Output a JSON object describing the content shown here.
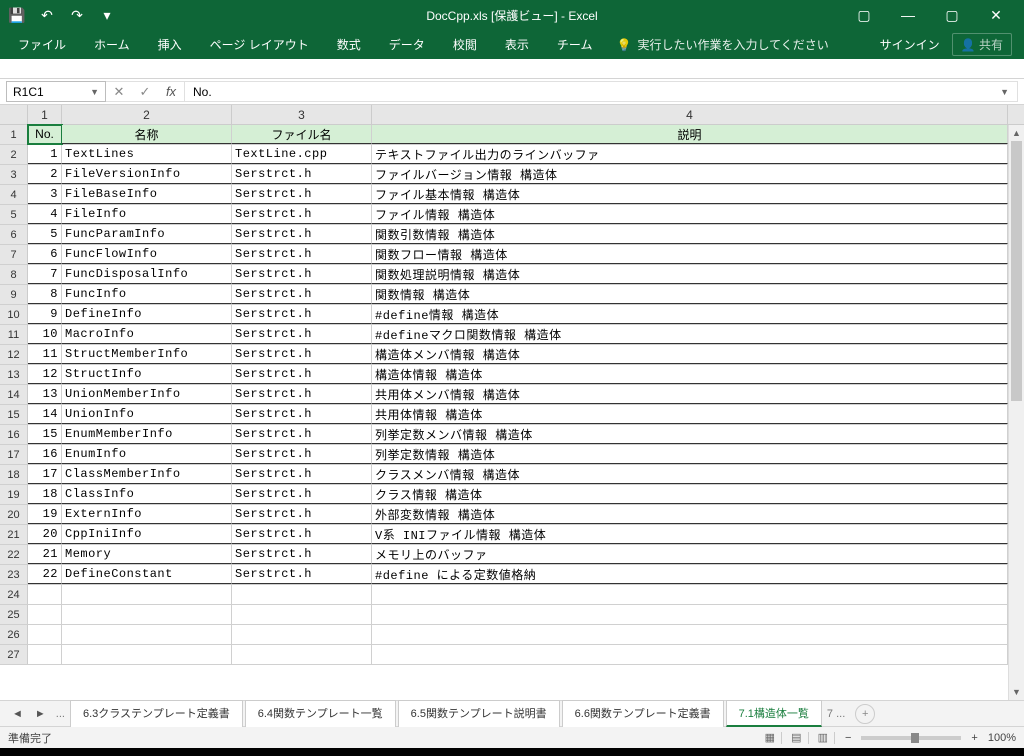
{
  "title": "DocCpp.xls [保護ビュー] - Excel",
  "qat": {
    "save": "💾",
    "undo": "↶",
    "redo": "↷",
    "more": "▾"
  },
  "winctrl": {
    "opts": "▢",
    "min": "—",
    "max": "▢",
    "close": "✕"
  },
  "ribbon": {
    "file": "ファイル",
    "home": "ホーム",
    "insert": "挿入",
    "pageLayout": "ページ レイアウト",
    "formulas": "数式",
    "data": "データ",
    "review": "校閲",
    "view": "表示",
    "team": "チーム",
    "tellme": "実行したい作業を入力してください",
    "signin": "サインイン",
    "share": "共有"
  },
  "namebox": "R1C1",
  "fx_value": "No.",
  "colheads": [
    "1",
    "2",
    "3",
    "4"
  ],
  "headers": {
    "no": "No.",
    "name": "名称",
    "file": "ファイル名",
    "desc": "説明"
  },
  "rows": [
    {
      "n": "1",
      "name": "TextLines",
      "file": "TextLine.cpp",
      "desc": "テキストファイル出力のラインバッファ"
    },
    {
      "n": "2",
      "name": "FileVersionInfo",
      "file": "Serstrct.h",
      "desc": "ファイルバージョン情報 構造体"
    },
    {
      "n": "3",
      "name": "FileBaseInfo",
      "file": "Serstrct.h",
      "desc": "ファイル基本情報 構造体"
    },
    {
      "n": "4",
      "name": "FileInfo",
      "file": "Serstrct.h",
      "desc": "ファイル情報 構造体"
    },
    {
      "n": "5",
      "name": "FuncParamInfo",
      "file": "Serstrct.h",
      "desc": "関数引数情報 構造体"
    },
    {
      "n": "6",
      "name": "FuncFlowInfo",
      "file": "Serstrct.h",
      "desc": "関数フロー情報 構造体"
    },
    {
      "n": "7",
      "name": "FuncDisposalInfo",
      "file": "Serstrct.h",
      "desc": "関数処理説明情報 構造体"
    },
    {
      "n": "8",
      "name": "FuncInfo",
      "file": "Serstrct.h",
      "desc": "関数情報 構造体"
    },
    {
      "n": "9",
      "name": "DefineInfo",
      "file": "Serstrct.h",
      "desc": "#define情報 構造体"
    },
    {
      "n": "10",
      "name": "MacroInfo",
      "file": "Serstrct.h",
      "desc": "#defineマクロ関数情報 構造体"
    },
    {
      "n": "11",
      "name": "StructMemberInfo",
      "file": "Serstrct.h",
      "desc": "構造体メンバ情報 構造体"
    },
    {
      "n": "12",
      "name": "StructInfo",
      "file": "Serstrct.h",
      "desc": "構造体情報 構造体"
    },
    {
      "n": "13",
      "name": "UnionMemberInfo",
      "file": "Serstrct.h",
      "desc": "共用体メンバ情報 構造体"
    },
    {
      "n": "14",
      "name": "UnionInfo",
      "file": "Serstrct.h",
      "desc": "共用体情報 構造体"
    },
    {
      "n": "15",
      "name": "EnumMemberInfo",
      "file": "Serstrct.h",
      "desc": "列挙定数メンバ情報 構造体"
    },
    {
      "n": "16",
      "name": "EnumInfo",
      "file": "Serstrct.h",
      "desc": "列挙定数情報 構造体"
    },
    {
      "n": "17",
      "name": "ClassMemberInfo",
      "file": "Serstrct.h",
      "desc": "クラスメンバ情報 構造体"
    },
    {
      "n": "18",
      "name": "ClassInfo",
      "file": "Serstrct.h",
      "desc": "クラス情報 構造体"
    },
    {
      "n": "19",
      "name": "ExternInfo",
      "file": "Serstrct.h",
      "desc": "外部変数情報 構造体"
    },
    {
      "n": "20",
      "name": "CppIniInfo",
      "file": "Serstrct.h",
      "desc": "V系 INIファイル情報 構造体"
    },
    {
      "n": "21",
      "name": "Memory",
      "file": "Serstrct.h",
      "desc": "メモリ上のバッファ"
    },
    {
      "n": "22",
      "name": "DefineConstant",
      "file": "Serstrct.h",
      "desc": "#define による定数値格納"
    }
  ],
  "empty_rows": [
    "24",
    "25",
    "26",
    "27"
  ],
  "sheets": {
    "tabs": [
      "6.3クラステンプレート定義書",
      "6.4関数テンプレート一覧",
      "6.5関数テンプレート説明書",
      "6.6関数テンプレート定義書",
      "7.1構造体一覧"
    ],
    "active": 4,
    "next": "7 ..."
  },
  "status": {
    "ready": "準備完了",
    "zoom": "100%"
  }
}
